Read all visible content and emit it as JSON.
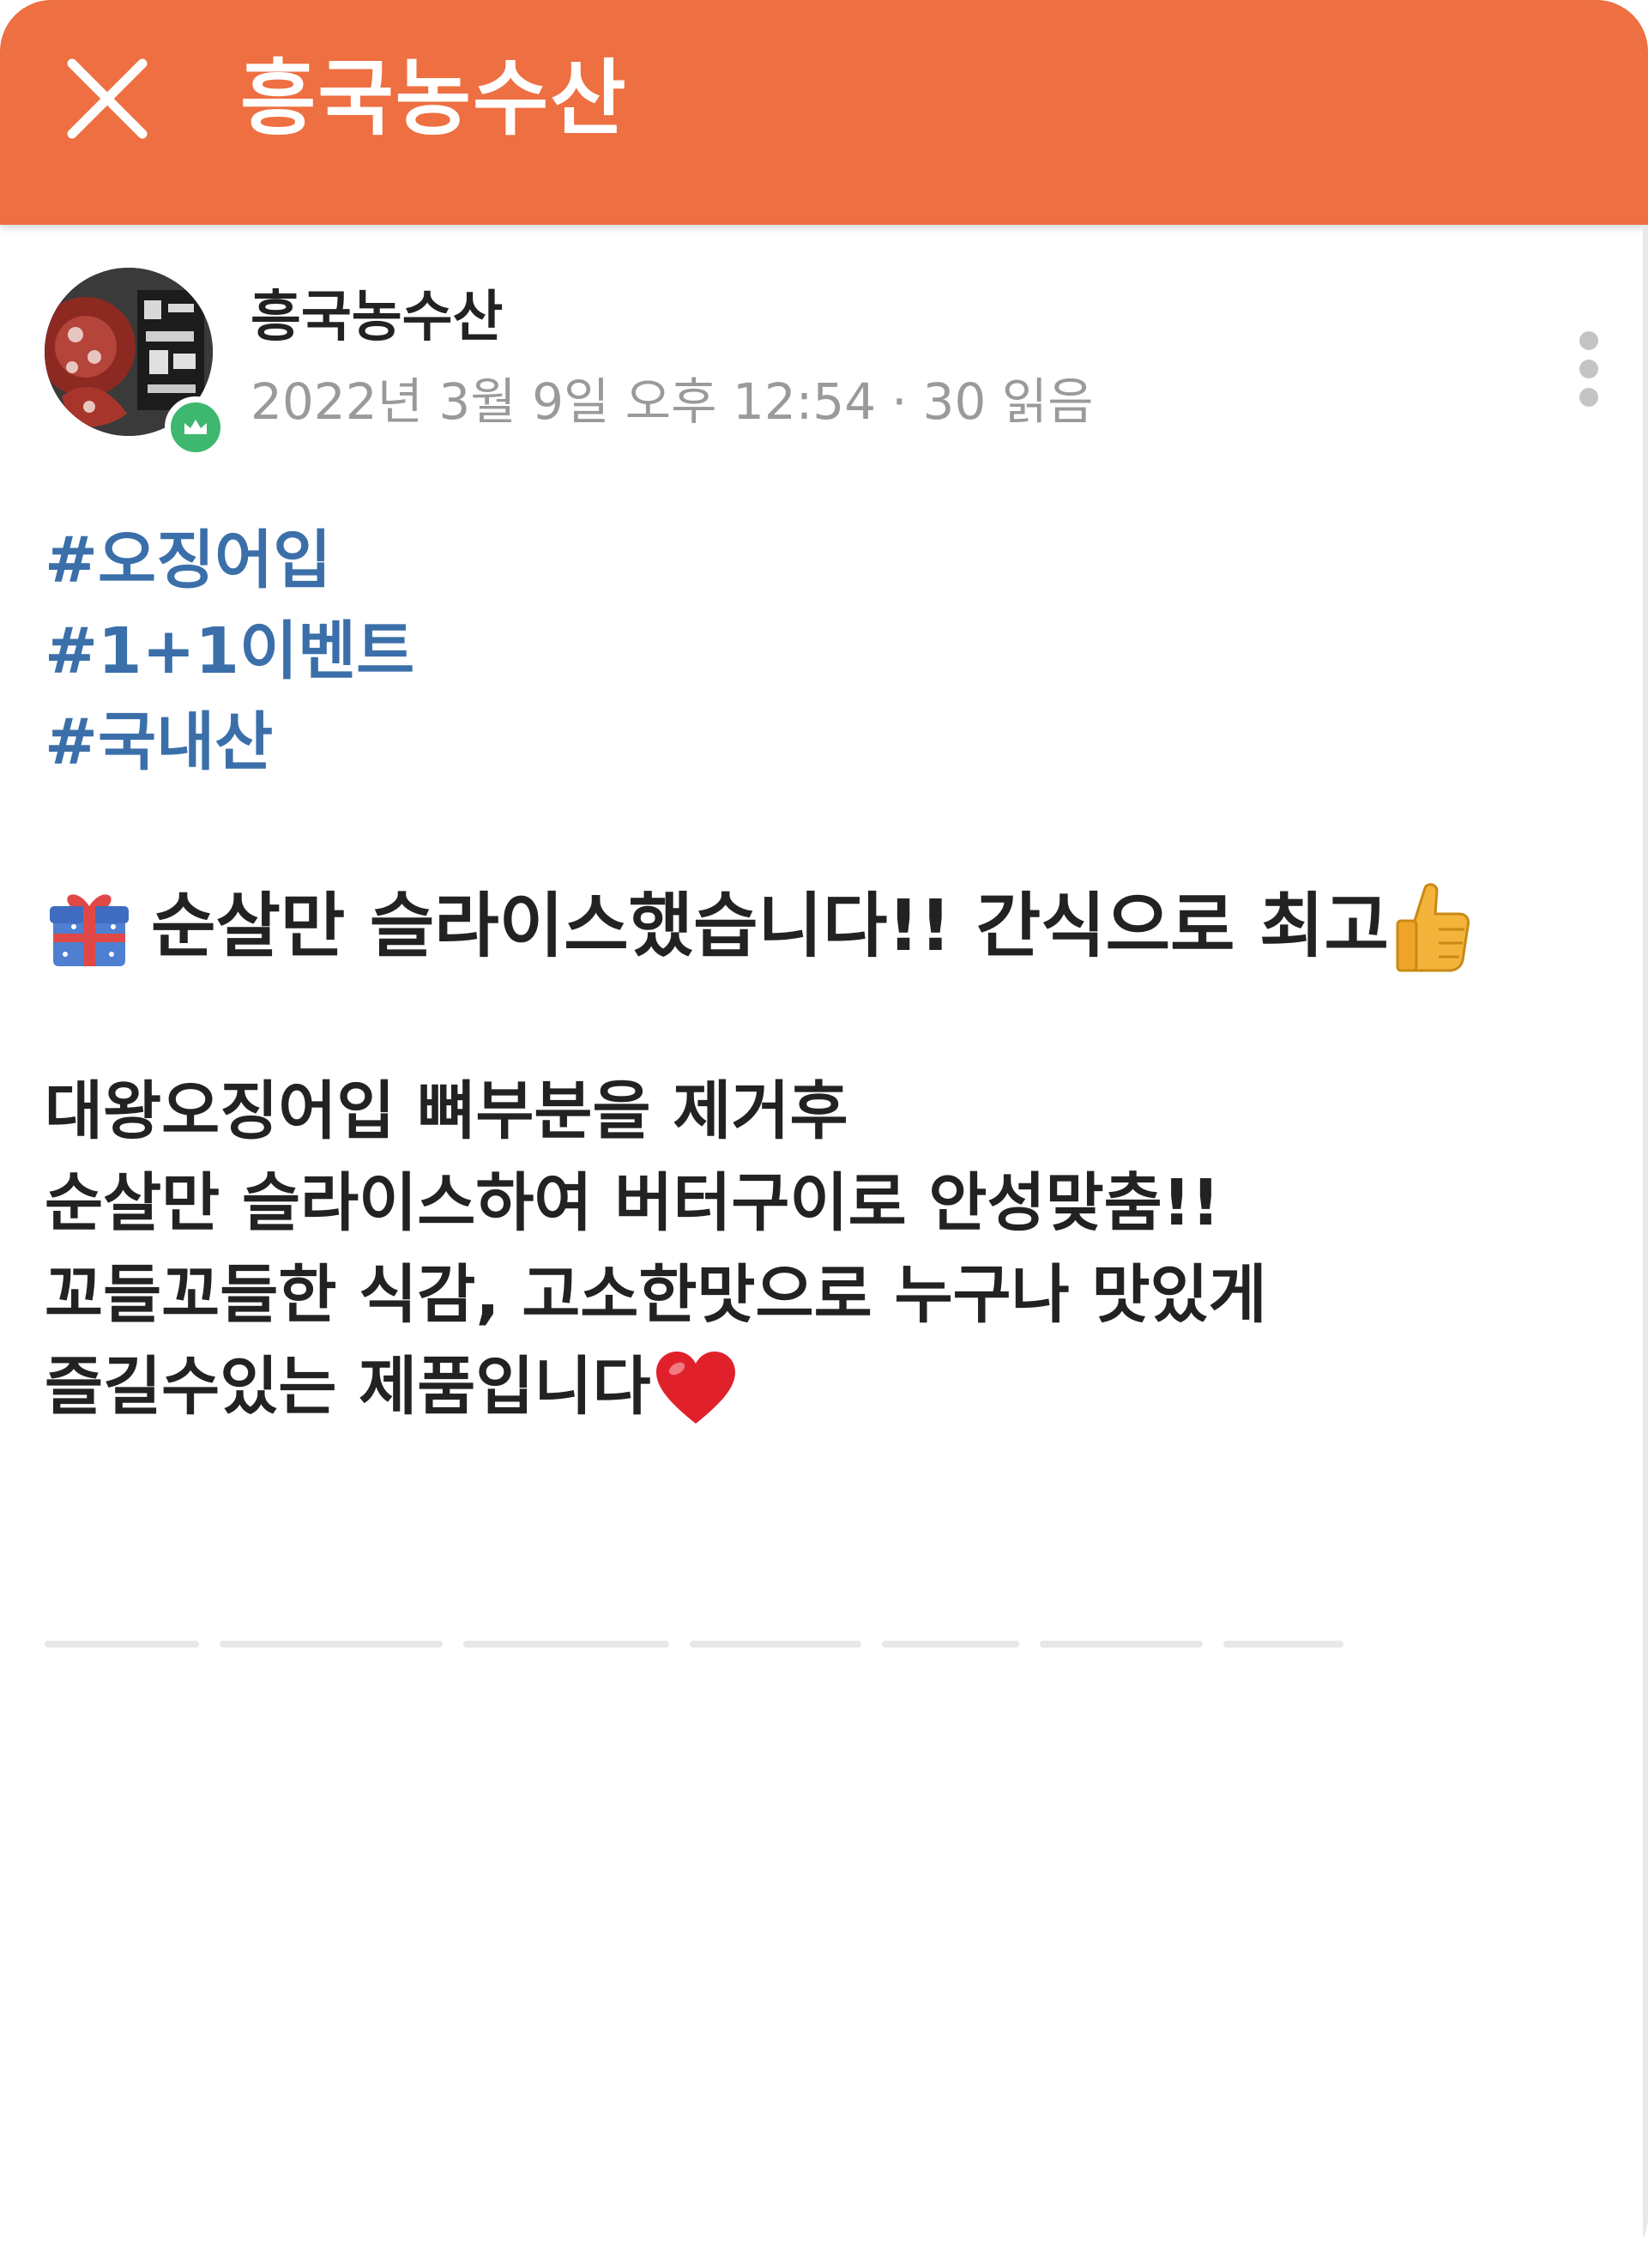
{
  "colors": {
    "appbar": "#ee6f41",
    "hashtag": "#3b6faa",
    "meta": "#9a9a9a",
    "badge": "#3db86e"
  },
  "appbar": {
    "close_icon": "close-icon",
    "title": "흥국농수산"
  },
  "post": {
    "author": "흥국농수산",
    "date": "2022년 3월 9일 오후 12:54",
    "separator": "·",
    "reads": "30 읽음",
    "more_icon": "more-vertical-icon",
    "hashtags": [
      "#오징어입",
      "#1+1이벤트",
      "#국내산"
    ],
    "headline": {
      "icon": "gift-icon",
      "text": "순살만 슬라이스했습니다!! 간식으로 최고",
      "trailing_icon": "thumbs-up-icon"
    },
    "body": [
      "대왕오징어입 뼈부분을 제거후",
      "순살만 슬라이스하여 버터구이로 안성맞춤!!",
      "꼬들꼬들한 식감, 고소한맛으로 누구나 맛있게",
      "즐길수있는 제품입니다"
    ],
    "body_trailing_icon": "heart-icon"
  }
}
